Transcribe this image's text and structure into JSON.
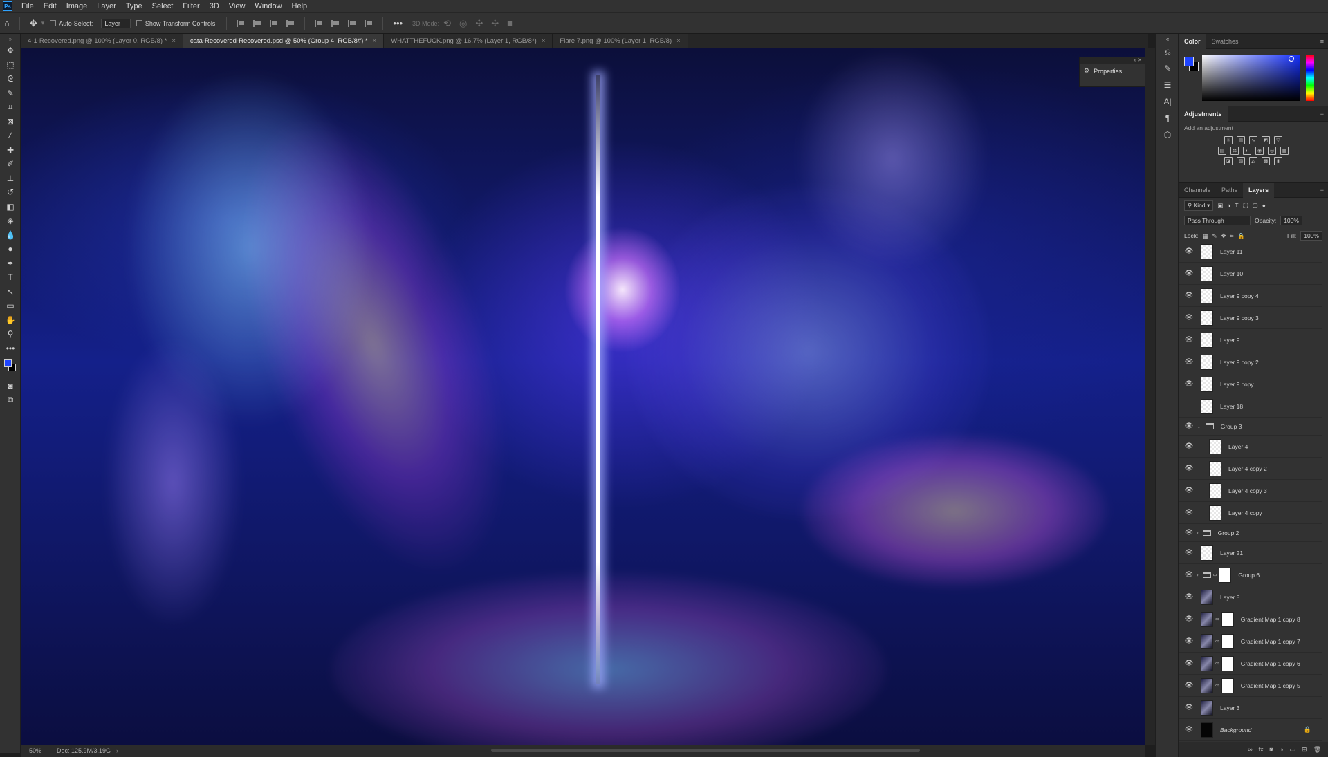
{
  "menubar": {
    "items": [
      "File",
      "Edit",
      "Image",
      "Layer",
      "Type",
      "Select",
      "Filter",
      "3D",
      "View",
      "Window",
      "Help"
    ]
  },
  "options": {
    "auto_select": "Auto-Select:",
    "auto_select_value": "Layer",
    "show_transform": "Show Transform Controls",
    "mode_3d": "3D Mode:"
  },
  "tabs": [
    {
      "label": "4-1-Recovered.png @ 100% (Layer 0, RGB/8) *",
      "active": false
    },
    {
      "label": "cata-Recovered-Recovered.psd @ 50% (Group 4, RGB/8#) *",
      "active": true
    },
    {
      "label": "WHATTHEFUCK.png @ 16.7% (Layer 1, RGB/8*)",
      "active": false
    },
    {
      "label": "Flare 7.png @ 100% (Layer 1, RGB/8)",
      "active": false
    }
  ],
  "properties_float": {
    "label": "Properties"
  },
  "status": {
    "zoom": "50%",
    "doc": "Doc: 125.9M/3.19G"
  },
  "color_panel": {
    "tabs": [
      "Color",
      "Swatches"
    ],
    "fg": "#1e44ff",
    "bg": "#000000"
  },
  "adjustments": {
    "title": "Adjustments",
    "subtitle": "Add an adjustment"
  },
  "layers_panel": {
    "tabs": [
      "Channels",
      "Paths",
      "Layers"
    ],
    "kind": "Kind",
    "blend_mode": "Pass Through",
    "opacity_label": "Opacity:",
    "opacity": "100%",
    "lock_label": "Lock:",
    "fill_label": "Fill:",
    "fill": "100%"
  },
  "layers": [
    {
      "name": "Layer 11",
      "visible": true,
      "kind": "pixel"
    },
    {
      "name": "Layer 10",
      "visible": true,
      "kind": "pixel"
    },
    {
      "name": "Layer 9 copy 4",
      "visible": true,
      "kind": "pixel"
    },
    {
      "name": "Layer 9 copy 3",
      "visible": true,
      "kind": "pixel"
    },
    {
      "name": "Layer 9",
      "visible": true,
      "kind": "pixel"
    },
    {
      "name": "Layer 9 copy 2",
      "visible": true,
      "kind": "pixel"
    },
    {
      "name": "Layer 9 copy",
      "visible": true,
      "kind": "pixel"
    },
    {
      "name": "Layer 18",
      "visible": false,
      "kind": "pixel"
    },
    {
      "name": "Group 3",
      "visible": true,
      "kind": "group-open"
    },
    {
      "name": "Layer 4",
      "visible": true,
      "kind": "pixel-indent"
    },
    {
      "name": "Layer 4 copy 2",
      "visible": true,
      "kind": "pixel-indent"
    },
    {
      "name": "Layer 4 copy 3",
      "visible": true,
      "kind": "pixel-indent"
    },
    {
      "name": "Layer 4 copy",
      "visible": true,
      "kind": "pixel-indent"
    },
    {
      "name": "Group 2",
      "visible": true,
      "kind": "group"
    },
    {
      "name": "Layer 21",
      "visible": true,
      "kind": "pixel"
    },
    {
      "name": "Group 6",
      "visible": true,
      "kind": "group-mask"
    },
    {
      "name": "Layer 8",
      "visible": true,
      "kind": "image"
    },
    {
      "name": "Gradient Map 1 copy 8",
      "visible": true,
      "kind": "adjust"
    },
    {
      "name": "Gradient Map 1 copy 7",
      "visible": true,
      "kind": "adjust"
    },
    {
      "name": "Gradient Map 1 copy 6",
      "visible": true,
      "kind": "adjust"
    },
    {
      "name": "Gradient Map 1 copy 5",
      "visible": true,
      "kind": "adjust"
    },
    {
      "name": "Layer 3",
      "visible": true,
      "kind": "image"
    },
    {
      "name": "Background",
      "visible": true,
      "kind": "background"
    }
  ]
}
